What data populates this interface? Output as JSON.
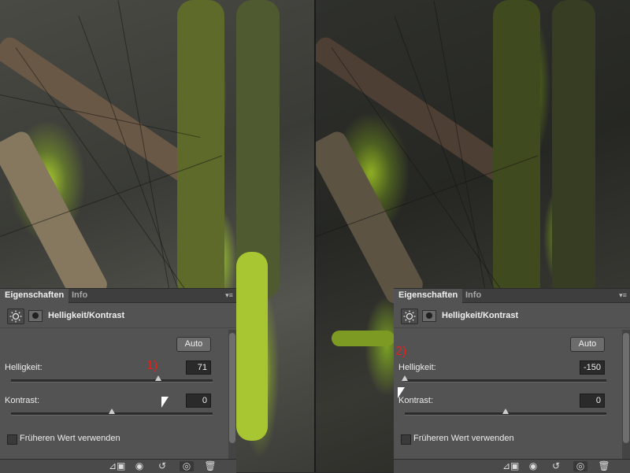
{
  "panels": [
    {
      "tabs": [
        "Eigenschaften",
        "Info"
      ],
      "title": "Helligkeit/Kontrast",
      "auto_label": "Auto",
      "helligkeit_label": "Helligkeit:",
      "helligkeit_value": "71",
      "helligkeit_fraction": 0.73,
      "kontrast_label": "Kontrast:",
      "kontrast_value": "0",
      "kontrast_fraction": 0.5,
      "checkbox_label": "Früheren Wert verwenden",
      "annotation": "1)"
    },
    {
      "tabs": [
        "Eigenschaften",
        "Info"
      ],
      "title": "Helligkeit/Kontrast",
      "auto_label": "Auto",
      "helligkeit_label": "Helligkeit:",
      "helligkeit_value": "-150",
      "helligkeit_fraction": 0.0,
      "kontrast_label": "Kontrast:",
      "kontrast_value": "0",
      "kontrast_fraction": 0.5,
      "checkbox_label": "Früheren Wert verwenden",
      "annotation": "2)"
    }
  ],
  "icons": {
    "adjustment": "sun-adjustment-icon",
    "mask": "layer-mask-icon",
    "menu": "panel-menu-icon",
    "footer": [
      "clip-to-layer-icon",
      "view-previous-state-icon",
      "reset-icon",
      "visibility-eye-icon",
      "trash-icon"
    ]
  },
  "colors": {
    "annotation": "#e0231d",
    "panel_bg": "#535353"
  }
}
